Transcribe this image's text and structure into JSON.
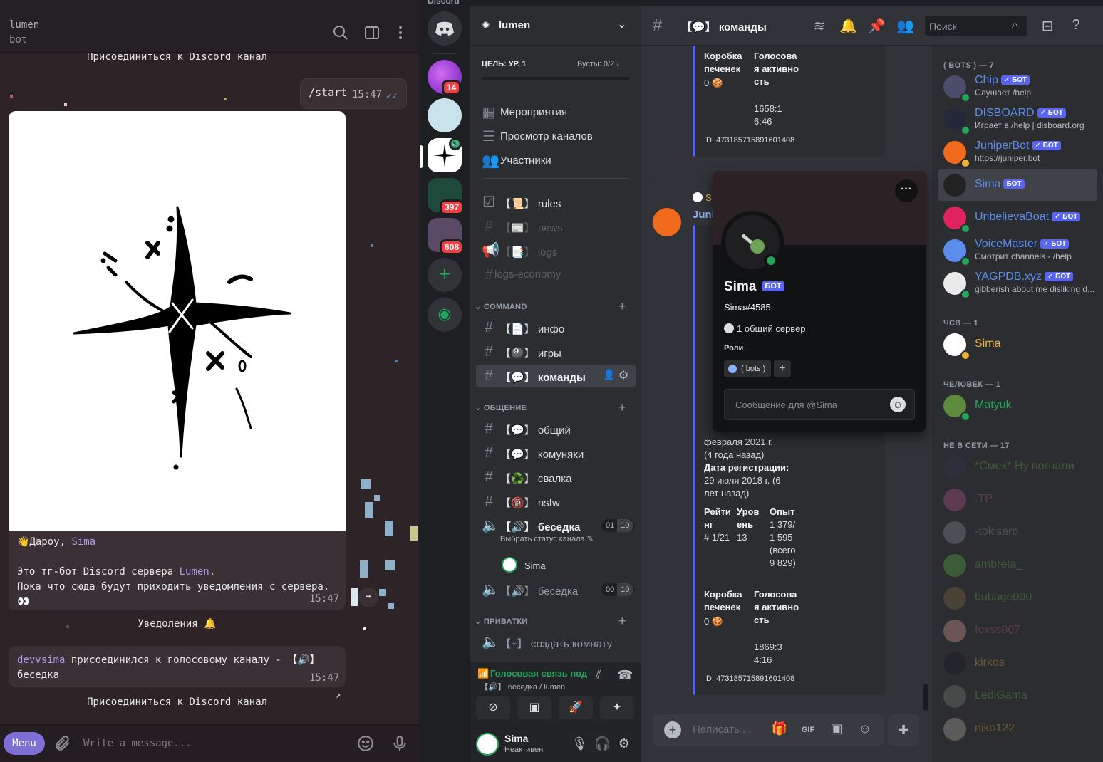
{
  "telegram": {
    "header": {
      "title": "lumen",
      "subtitle": "bot"
    },
    "system_join_top": "Присоединиться к Discord канал",
    "outgoing": {
      "text": "/start",
      "time": "15:47"
    },
    "welcome": {
      "greeting_prefix": "👋Дароу,",
      "greeting_name": "Sima",
      "line1_prefix": "Это тг-бот Discord сервера",
      "line1_link": "Lumen",
      "line1_suffix": ".",
      "line2": "Пока что сюда будут приходить уведомления с сервера. 👀",
      "time": "15:47"
    },
    "notifications_label": "Уведоления 🔔",
    "voice_msg": {
      "user": "devvsima",
      "text": " присоединился к голосовому каналу - 【🔊】 беседка",
      "time": "15:47"
    },
    "join_button": "Присоединиться к Discord канал",
    "input": {
      "menu": "Menu",
      "placeholder": "Write a message..."
    }
  },
  "discord": {
    "app_title": "Discord",
    "guild_badges": [
      "14",
      "397",
      "608"
    ],
    "server": {
      "name": "lumen"
    },
    "boost": {
      "goal": "ЦЕЛЬ: УР. 1",
      "count": "Бусты: 0/2"
    },
    "nav": [
      "Мероприятия",
      "Просмотр каналов",
      "Участники"
    ],
    "channels_top": [
      {
        "icon": "📋",
        "label": "【📜】 rules",
        "style": "bright"
      },
      {
        "icon": "#",
        "label": "【📰】 news",
        "style": "dim"
      },
      {
        "icon": "📢",
        "label": "【📑】 logs",
        "style": "dim"
      },
      {
        "icon": "#",
        "label": "logs-economy",
        "style": "dim"
      }
    ],
    "categories": {
      "command": "COMMAND",
      "general": "ОБЩЕНИЕ",
      "private": "ПРИВАТКИ"
    },
    "command_channels": [
      "【📄】 инфо",
      "【🎱】 игры",
      "【💬】 команды"
    ],
    "general_channels": [
      "【💬】 общий",
      "【💬】 комуняки",
      "【♻️】 свалка",
      "【🔞】 nsfw"
    ],
    "voice1": {
      "label": "【🔊】 беседка",
      "count_a": "01",
      "count_b": "10",
      "status": "Выбрать статус канала",
      "member": "Sima"
    },
    "voice2": {
      "label": "【🔊】 беседка",
      "count_a": "00",
      "count_b": "10"
    },
    "private_channel": "【+】 создать комнату",
    "voice_status": {
      "title": "Голосовая связь под",
      "sub": "【🔊】 беседка / lumen"
    },
    "user": {
      "name": "Sima",
      "status": "Неактивен"
    },
    "topbar": {
      "title": "【💬】 команды",
      "search": "Поиск"
    },
    "card1": {
      "cookie_label": "Коробка печенек",
      "cookie_value": "0 🍪",
      "activity_label": "Голосовая активность",
      "activity_value": "1658:16:46",
      "id": "ID: 473185715891601408"
    },
    "card2": {
      "reply_label": "S",
      "author": "Juni",
      "reg_date_partial": "февраля 2021 г. (4 года назад)",
      "reg_label": "Дата регистрации:",
      "reg_value": "29 июля 2018 г. (6 лет назад)",
      "rating_label": "Рейтинг",
      "rating_value": "# 1/21",
      "level_label": "Уровень",
      "level_value": "13",
      "exp_label": "Опыт",
      "exp_value": "1 379/ 1 595 (всего 9 829)",
      "cookie_label": "Коробка печенек",
      "cookie_value": "0 🍪",
      "activity_label": "Голосовая активность",
      "activity_value": "1869:34:16",
      "id": "ID: 473185715891601408"
    },
    "composer_placeholder": "Написать ...",
    "popout": {
      "name": "Sima",
      "badge": "БОТ",
      "tag": "Sima#4585",
      "mutual": "1 общий сервер",
      "roles_label": "Роли",
      "role": "( bots )",
      "message_placeholder": "Сообщение для @Sima"
    },
    "members": {
      "bots_header": "( BOTS ) — 7",
      "bots": [
        {
          "name": "Chip",
          "sub": "Слушает /help",
          "color": "#5b8def"
        },
        {
          "name": "DISBOARD",
          "sub": "Играет в /help | disboard.org",
          "color": "#5b8def"
        },
        {
          "name": "JuniperBot",
          "sub": "https://juniper.bot",
          "color": "#5b8def"
        },
        {
          "name": "Sima",
          "sub": "",
          "color": "#5b8def"
        },
        {
          "name": "UnbelievaBoat",
          "sub": "",
          "color": "#5b8def"
        },
        {
          "name": "VoiceMaster",
          "sub": "Смотрит channels - /help",
          "color": "#5b8def"
        },
        {
          "name": "YAGPDB.xyz",
          "sub": "gibberish about me disliking d...",
          "color": "#5b8def"
        }
      ],
      "bot_badge": "БОТ",
      "csv_header": "ЧСВ — 1",
      "csv_member": "Sima",
      "human_header": "ЧЕЛОВЕК — 1",
      "human_member": "Matyuk",
      "offline_header": "НЕ В СЕТИ — 17",
      "offline": [
        {
          "name": "*Смех* Ну погнали",
          "color": "#3e5b37"
        },
        {
          "name": ".TP",
          "color": "#5d3a4f"
        },
        {
          "name": "-tokisaro",
          "color": "#4e4f55"
        },
        {
          "name": "ambrela_",
          "color": "#3e5b37"
        },
        {
          "name": "bubage000",
          "color": "#3e5b37"
        },
        {
          "name": "foxss007",
          "color": "#5d3a4f"
        },
        {
          "name": "kirkos",
          "color": "#6b5a2f"
        },
        {
          "name": "LediGama",
          "color": "#3e5b37"
        },
        {
          "name": "niko122",
          "color": "#6b5a2f"
        }
      ]
    }
  }
}
